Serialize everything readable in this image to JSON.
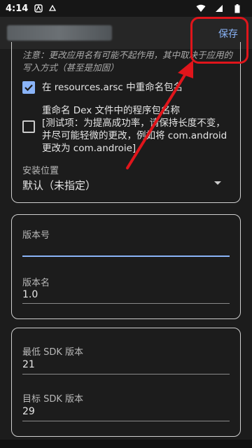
{
  "status_bar": {
    "time": "4:14"
  },
  "app_bar": {
    "save_label": "保存"
  },
  "card1": {
    "note": "注意：更改应用名有可能不起作用，其中取决于应用的写入方式（甚至是加固）",
    "rename_package_arsc": {
      "label": "在 resources.arsc 中重命名包名",
      "checked": true
    },
    "rename_package_dex": {
      "label": "重命名 Dex 文件中的程序包名称",
      "hint_line1": "[测试项：为提高成功率，请保持长度不变，",
      "hint_line2": "并尽可能轻微的更改，例如将 com.android",
      "hint_line3": "更改为 com.androie]",
      "checked": false
    },
    "install_location": {
      "label": "安装位置",
      "value": "默认（未指定）"
    }
  },
  "card2": {
    "version_code": {
      "label": "版本号",
      "value": ""
    },
    "version_name": {
      "label": "版本名",
      "value": "1.0"
    }
  },
  "card3": {
    "min_sdk": {
      "label": "最低 SDK 版本",
      "value": "21"
    },
    "target_sdk": {
      "label": "目标 SDK 版本",
      "value": "29"
    }
  },
  "colors": {
    "accent": "#8ab4f8",
    "annotation": "#e0151b"
  }
}
